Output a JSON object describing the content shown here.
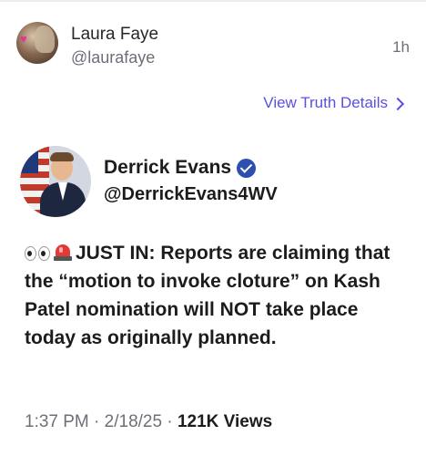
{
  "retruth": {
    "name": "Laura Faye",
    "handle": "@laurafaye",
    "time": "1h",
    "view_details_label": "View Truth Details"
  },
  "post": {
    "author_name": "Derrick Evans",
    "author_handle": "@DerrickEvans4WV",
    "body": "JUST IN: Reports are claiming that the “motion to invoke cloture” on Kash Patel nomination will NOT take place today as originally planned.",
    "time": "1:37 PM",
    "date": "2/18/25",
    "views_count": "121K",
    "views_label": "Views"
  },
  "colors": {
    "accent": "#5b4fe3",
    "verified": "#2d4fb0",
    "muted": "#6e6e78",
    "text": "#1c1c1e"
  },
  "icons": [
    "eyes-emoji-icon",
    "siren-emoji-icon",
    "verified-badge-icon",
    "chevron-right-icon"
  ]
}
